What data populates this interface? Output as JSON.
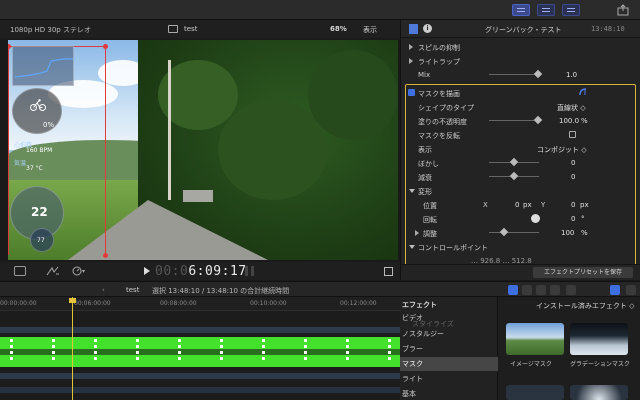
{
  "viewer": {
    "format": "1080p HD 30p ステレオ",
    "clip_name": "test",
    "zoom": "68%",
    "view_menu": "表示",
    "timecode_dim": "00:0",
    "timecode": "6:09:17",
    "overlay": {
      "percent": "0%",
      "heart_rate_label": "心拍数",
      "heart_rate": "160 BPM",
      "temp_label": "気温",
      "temperature": "37 °C",
      "speed": "22",
      "cadence": "77"
    }
  },
  "inspector": {
    "title": "グリーンバック・テスト",
    "timecode": "13:48:10",
    "rows": {
      "spill": "スピルの抑制",
      "light_wrap": "ライトラップ",
      "mix_label": "Mix",
      "mix_value": "1.0",
      "draw_mask": "マスクを描画",
      "shape_type_label": "シェイプのタイプ",
      "shape_type_value": "直線状 ◇",
      "fill_opacity_label": "塗りの不透明度",
      "fill_opacity_value": "100.0",
      "fill_opacity_unit": "%",
      "invert_mask": "マスクを反転",
      "view_label": "表示",
      "view_value": "コンポジット ◇",
      "blur_label": "ぼかし",
      "blur_value": "0",
      "falloff_label": "減衰",
      "falloff_value": "0",
      "transform_label": "変形",
      "position_label": "位置",
      "pos_x_label": "X",
      "pos_x_value": "0",
      "pos_x_unit": "px",
      "pos_y_label": "Y",
      "pos_y_value": "0",
      "pos_y_unit": "px",
      "rotation_label": "回転",
      "rotation_value": "0",
      "rotation_unit": "°",
      "scale_label": "調整",
      "scale_value": "100",
      "scale_unit": "%",
      "control_points": "コントロールポイント",
      "partial_row": "…  926.8  …  512.8"
    },
    "save_preset": "エフェクトプリセットを保存"
  },
  "timeline": {
    "project": "test",
    "selection": "選択 13:48:10 / 13:48:10 の合計継続時間",
    "ticks": [
      "00:00:00:00",
      "00:06:00:00",
      "00:08:00:00",
      "00:10:00:00",
      "00:12:00:00"
    ]
  },
  "effects": {
    "header": "エフェクト",
    "installed": "インストール済みエフェクト ◇",
    "categories": [
      "ビデオ",
      "スタイライズ",
      "ノスタルジー",
      "ブラー",
      "マスク",
      "ライト",
      "基本"
    ],
    "selected_category": "マスク",
    "thumbs": [
      {
        "label": "イメージマスク"
      },
      {
        "label": "グラデーションマスク"
      }
    ]
  }
}
